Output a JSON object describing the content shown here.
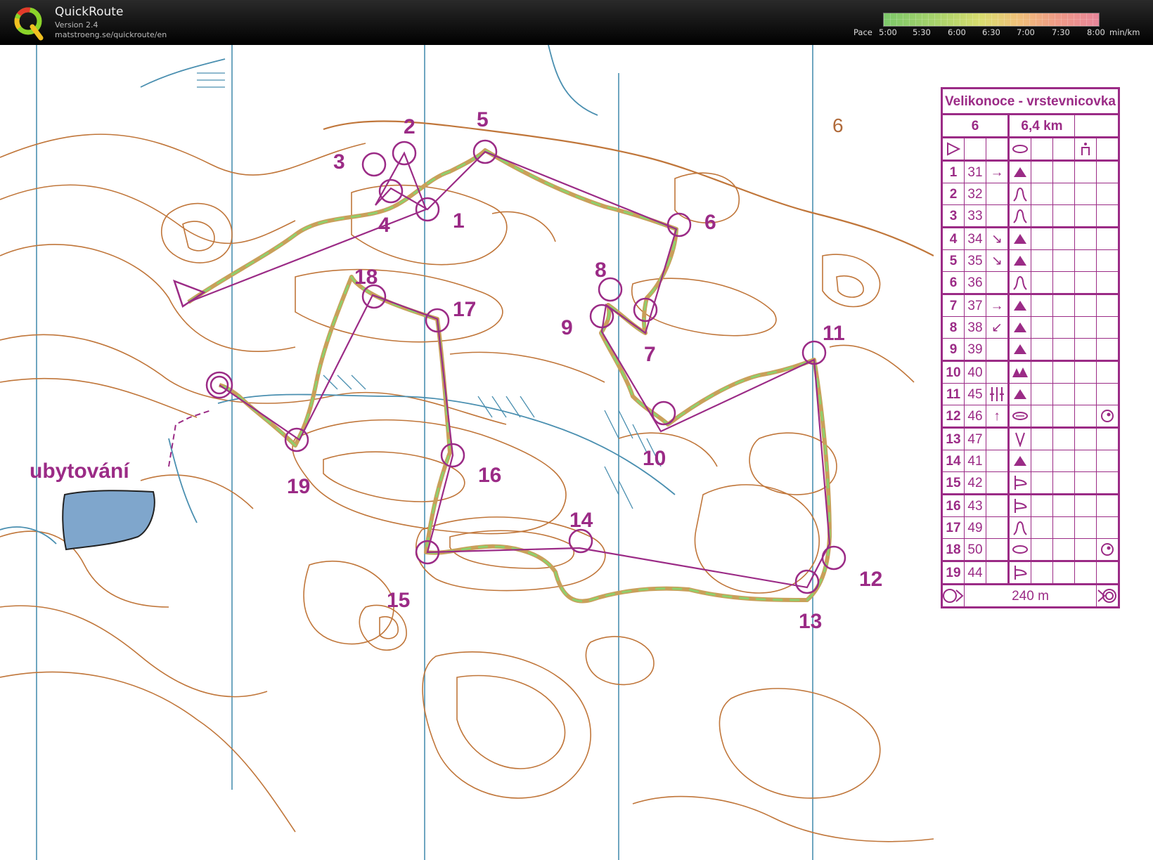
{
  "app": {
    "name": "QuickRoute",
    "version": "Version 2.4",
    "url": "matstroeng.se/quickroute/en"
  },
  "pace_scale": {
    "prefix": "Pace",
    "ticks": [
      "5:00",
      "5:30",
      "6:00",
      "6:30",
      "7:00",
      "7:30",
      "8:00"
    ],
    "unit": "min/km",
    "colors": {
      "fast": "#7cc86a",
      "mid": "#d8dc6f",
      "slow": "#e8869a"
    }
  },
  "map": {
    "label": "ubytování",
    "sheet_number": "6",
    "colors": {
      "course": "#9b2b86",
      "contour": "#b5651d",
      "water": "#7fa6cc",
      "grid": "#4a8fb0"
    },
    "controls": [
      {
        "num": "1"
      },
      {
        "num": "2"
      },
      {
        "num": "3"
      },
      {
        "num": "4"
      },
      {
        "num": "5"
      },
      {
        "num": "6"
      },
      {
        "num": "7"
      },
      {
        "num": "8"
      },
      {
        "num": "9"
      },
      {
        "num": "10"
      },
      {
        "num": "11"
      },
      {
        "num": "12"
      },
      {
        "num": "13"
      },
      {
        "num": "14"
      },
      {
        "num": "15"
      },
      {
        "num": "16"
      },
      {
        "num": "17"
      },
      {
        "num": "18"
      },
      {
        "num": "19"
      }
    ]
  },
  "descriptions": {
    "title": "Velikonoce - vrstevnicovka",
    "course": "6",
    "length": "6,4 km",
    "finish_distance": "240 m",
    "rows": [
      {
        "n": "1",
        "code": "31",
        "dir": "→",
        "feature": "knoll"
      },
      {
        "n": "2",
        "code": "32",
        "dir": "",
        "feature": "spur"
      },
      {
        "n": "3",
        "code": "33",
        "dir": "",
        "feature": "spur"
      },
      {
        "n": "4",
        "code": "34",
        "dir": "↘",
        "feature": "knoll"
      },
      {
        "n": "5",
        "code": "35",
        "dir": "↘",
        "feature": "knoll"
      },
      {
        "n": "6",
        "code": "36",
        "dir": "",
        "feature": "spur"
      },
      {
        "n": "7",
        "code": "37",
        "dir": "→",
        "feature": "knoll"
      },
      {
        "n": "8",
        "code": "38",
        "dir": "↙",
        "feature": "knoll"
      },
      {
        "n": "9",
        "code": "39",
        "dir": "",
        "feature": "knoll"
      },
      {
        "n": "10",
        "code": "40",
        "dir": "",
        "feature": "knolls"
      },
      {
        "n": "11",
        "code": "45",
        "dir": "",
        "feature": "knoll"
      },
      {
        "n": "12",
        "code": "46",
        "dir": "↑",
        "feature": "depression"
      },
      {
        "n": "13",
        "code": "47",
        "dir": "",
        "feature": "reentrant"
      },
      {
        "n": "14",
        "code": "41",
        "dir": "",
        "feature": "knoll"
      },
      {
        "n": "15",
        "code": "42",
        "dir": "",
        "feature": "spur-end"
      },
      {
        "n": "16",
        "code": "43",
        "dir": "",
        "feature": "spur-end"
      },
      {
        "n": "17",
        "code": "49",
        "dir": "",
        "feature": "spur"
      },
      {
        "n": "18",
        "code": "50",
        "dir": "",
        "feature": "depression"
      },
      {
        "n": "19",
        "code": "44",
        "dir": "",
        "feature": "spur-end"
      }
    ]
  }
}
